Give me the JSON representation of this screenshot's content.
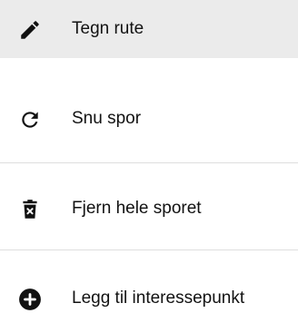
{
  "menu": {
    "items": [
      {
        "label": "Tegn rute",
        "icon": "pencil-icon",
        "active": true
      },
      {
        "label": "Snu spor",
        "icon": "reverse-arrow-icon",
        "active": false
      },
      {
        "label": "Fjern hele sporet",
        "icon": "trash-icon",
        "active": false
      },
      {
        "label": "Legg til interessepunkt",
        "icon": "plus-circle-icon",
        "active": false
      }
    ]
  },
  "colors": {
    "active_background": "#ebebeb",
    "divider": "#dedede",
    "icon": "#111111",
    "text": "#121212"
  }
}
